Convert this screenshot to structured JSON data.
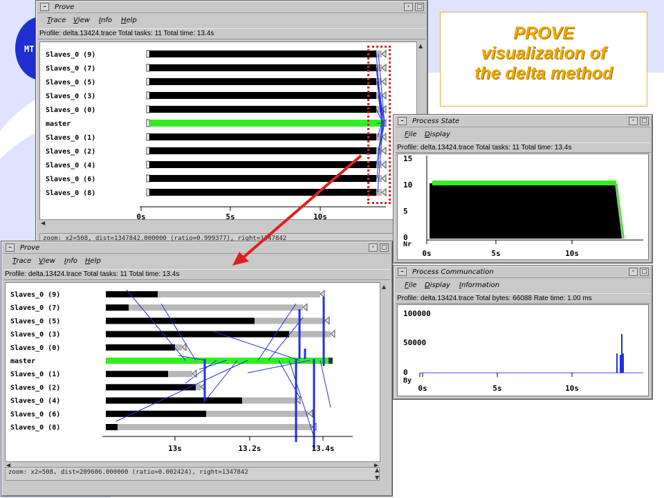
{
  "colors": {
    "background_blob": "#dfe3ff",
    "logo_blue": "#1f2fd0",
    "window_gray": "#c9c9c9",
    "master_green": "#33ee22",
    "slave_black": "#000000",
    "idle_gray": "#b8b8b8",
    "message_blue": "#2030e0",
    "arrow_red": "#e02020",
    "callout_orange": "#f0a800"
  },
  "logo": {
    "text": "MT"
  },
  "callout": {
    "line1": "PROVE",
    "line2": "visualization of",
    "line3": "the delta method"
  },
  "prove_window_top": {
    "title": "Prove",
    "menu": [
      "Trace",
      "View",
      "Info",
      "Help"
    ],
    "profile": "Profile: delta.13424.trace  Total tasks: 11  Total time: 13.4s",
    "processes": [
      "Slaves_0 (9)",
      "Slaves_0 (7)",
      "Slaves_0 (5)",
      "Slaves_0 (3)",
      "Slaves_0 (0)",
      "master",
      "Slaves_0 (1)",
      "Slaves_0 (2)",
      "Slaves_0 (4)",
      "Slaves_0 (6)",
      "Slaves_0 (8)"
    ],
    "axis_ticks": [
      "0s",
      "5s",
      "10s"
    ],
    "status": "zoom: x2=508, dist=1347842.000000 (ratio=0.999377), right=1347842"
  },
  "prove_window_zoom": {
    "title": "Prove",
    "menu": [
      "Trace",
      "View",
      "Info",
      "Help"
    ],
    "profile": "Profile: delta.13424.trace  Total tasks: 11  Total time: 13.4s",
    "processes": [
      "Slaves_0 (9)",
      "Slaves_0 (7)",
      "Slaves_0 (5)",
      "Slaves_0 (3)",
      "Slaves_0 (0)",
      "master",
      "Slaves_0 (1)",
      "Slaves_0 (2)",
      "Slaves_0 (4)",
      "Slaves_0 (6)",
      "Slaves_0 (8)"
    ],
    "axis_ticks": [
      "13s",
      "13.2s",
      "13.4s"
    ],
    "status": "zoom: x2=508, dist=209606.000000 (ratio=0.002424), right=1347842"
  },
  "process_state_window": {
    "title": "Process State",
    "menu": [
      "File",
      "Display"
    ],
    "profile": "Profile: delta.13424.trace  Total tasks: 11  Total time: 13.4s",
    "y_ticks": [
      "15",
      "10",
      "5",
      "0"
    ],
    "y_unit": "Nr",
    "x_ticks": [
      "0s",
      "5s",
      "10s"
    ]
  },
  "process_comm_window": {
    "title": "Process Communcation",
    "menu": [
      "File",
      "Display",
      "Information"
    ],
    "profile": "Profile: delta.13424.trace Total bytes: 66088 Rate time: 1.00 ms",
    "y_ticks": [
      "100000",
      "50000",
      "0"
    ],
    "y_unit": "By",
    "x_ticks": [
      "0s",
      "5s",
      "10s"
    ]
  }
}
